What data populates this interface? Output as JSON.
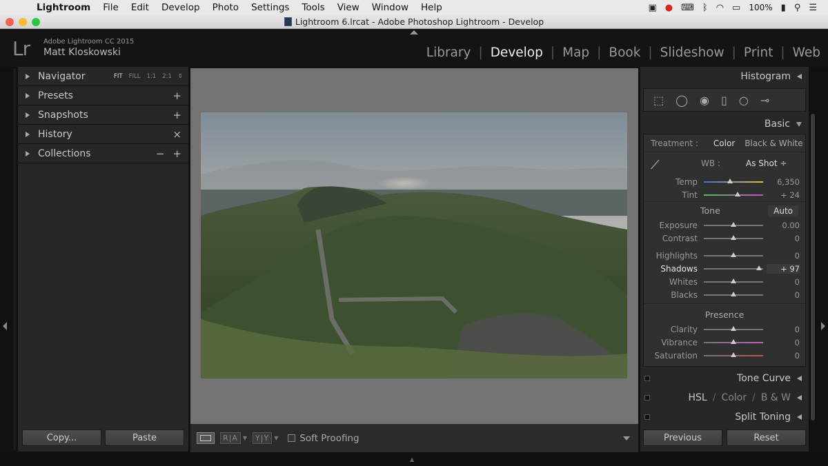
{
  "menubar": {
    "app": "Lightroom",
    "items": [
      "File",
      "Edit",
      "Develop",
      "Photo",
      "Settings",
      "Tools",
      "View",
      "Window",
      "Help"
    ],
    "battery": "100%"
  },
  "window": {
    "title": "Lightroom 6.lrcat - Adobe Photoshop Lightroom - Develop"
  },
  "identity": {
    "logo": "Lr",
    "product": "Adobe Lightroom CC 2015",
    "user": "Matt Kloskowski"
  },
  "modules": [
    "Library",
    "Develop",
    "Map",
    "Book",
    "Slideshow",
    "Print",
    "Web"
  ],
  "active_module": "Develop",
  "left_panels": {
    "navigator": {
      "label": "Navigator",
      "zoom": [
        "FIT",
        "FILL",
        "1:1",
        "2:1"
      ]
    },
    "presets": {
      "label": "Presets",
      "ctrl": "+"
    },
    "snapshots": {
      "label": "Snapshots",
      "ctrl": "+"
    },
    "history": {
      "label": "History",
      "ctrl": "×"
    },
    "collections": {
      "label": "Collections",
      "ctrl_minus": "−",
      "ctrl_plus": "+"
    }
  },
  "left_buttons": {
    "copy": "Copy...",
    "paste": "Paste"
  },
  "toolbar": {
    "before_after": "R|A",
    "yy": "Y|Y",
    "soft_proofing": "Soft Proofing"
  },
  "right_panel": {
    "histogram": "Histogram",
    "basic": "Basic",
    "treatment_label": "Treatment :",
    "treatment_color": "Color",
    "treatment_bw": "Black & White",
    "wb_label": "WB :",
    "wb_value": "As Shot ÷",
    "temp": {
      "label": "Temp",
      "value": "6,350",
      "pos": 0.44
    },
    "tint": {
      "label": "Tint",
      "value": "+ 24",
      "pos": 0.57
    },
    "tone_label": "Tone",
    "auto_label": "Auto",
    "tone_sliders": [
      {
        "label": "Exposure",
        "value": "0.00",
        "pos": 0.5
      },
      {
        "label": "Contrast",
        "value": "0",
        "pos": 0.5
      },
      {
        "label": "Highlights",
        "value": "0",
        "pos": 0.5
      },
      {
        "label": "Shadows",
        "value": "+ 97",
        "pos": 0.93,
        "active": true
      },
      {
        "label": "Whites",
        "value": "0",
        "pos": 0.5
      },
      {
        "label": "Blacks",
        "value": "0",
        "pos": 0.5
      }
    ],
    "presence_label": "Presence",
    "presence_sliders": [
      {
        "label": "Clarity",
        "value": "0",
        "pos": 0.5
      },
      {
        "label": "Vibrance",
        "value": "0",
        "pos": 0.5
      },
      {
        "label": "Saturation",
        "value": "0",
        "pos": 0.5
      }
    ],
    "tone_curve": "Tone Curve",
    "hsl": "HSL",
    "hsl_color": "Color",
    "hsl_bw": "B & W",
    "hsl_sep": "/",
    "split_toning": "Split Toning"
  },
  "right_buttons": {
    "previous": "Previous",
    "reset": "Reset"
  },
  "colors": {
    "accent_active": "#f2f2f2",
    "panel_bg": "#272727",
    "canvas_bg": "#737373"
  }
}
